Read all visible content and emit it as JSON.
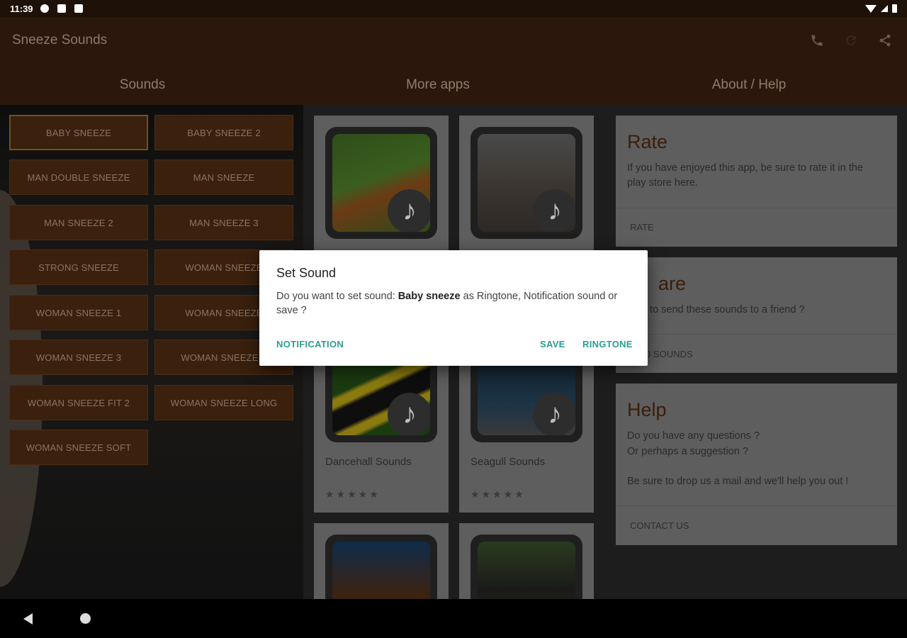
{
  "status_bar": {
    "time": "11:39"
  },
  "app_bar": {
    "title": "Sneeze Sounds",
    "tabs": [
      "Sounds",
      "More apps",
      "About / Help"
    ]
  },
  "sounds": [
    "BABY SNEEZE",
    "BABY SNEEZE 2",
    "MAN DOUBLE SNEEZE",
    "MAN SNEEZE",
    "MAN SNEEZE 2",
    "MAN SNEEZE 3",
    "STRONG SNEEZE",
    "WOMAN SNEEZE",
    "WOMAN SNEEZE 1",
    "WOMAN SNEEZE",
    "WOMAN SNEEZE 3",
    "WOMAN SNEEZE F",
    "WOMAN SNEEZE FIT 2",
    "WOMAN SNEEZE LONG",
    "WOMAN SNEEZE SOFT"
  ],
  "apps": [
    {
      "name": "Dancehall Sounds",
      "stars": "★★★★★"
    },
    {
      "name": "Seagull Sounds",
      "stars": "★★★★★"
    }
  ],
  "info": {
    "rate": {
      "title": "Rate",
      "body": "If you have enjoyed this app, be sure to rate it in the play store here.",
      "action": "RATE"
    },
    "share": {
      "title": "are",
      "body": "t to send these sounds to a friend ?",
      "action": "D SOUNDS"
    },
    "help": {
      "title": "Help",
      "body1": "Do you have any questions ?",
      "body2": "Or perhaps a suggestion ?",
      "body3": "Be sure to drop us a mail and we'll help you out !",
      "action": "CONTACT US"
    }
  },
  "dialog": {
    "title": "Set Sound",
    "msg_pre": "Do you want to set sound: ",
    "msg_sound": "Baby sneeze",
    "msg_post": " as Ringtone, Notification sound or save ?",
    "notification": "NOTIFICATION",
    "save": "SAVE",
    "ringtone": "RINGTONE"
  },
  "icons": {
    "phone": "phone-icon",
    "refresh": "refresh-icon",
    "share": "share-icon"
  },
  "colors": {
    "app_bar": "#2b170b",
    "sound_button": "#3a200d",
    "dialog_accent": "#2a9d8f"
  }
}
